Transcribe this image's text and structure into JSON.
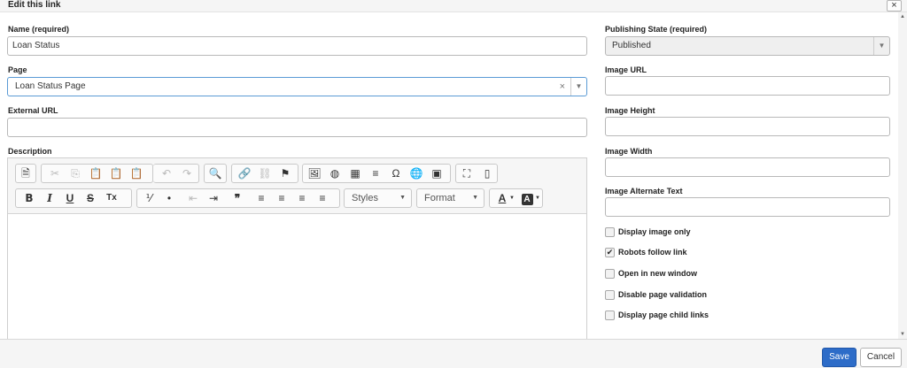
{
  "dialog": {
    "title": "Edit this link",
    "close_icon": "×"
  },
  "left": {
    "name_label": "Name (required)",
    "name_value": "Loan Status",
    "page_label": "Page",
    "page_value": "Loan Status Page",
    "page_clear_icon": "×",
    "page_arrow_icon": "▼",
    "external_url_label": "External URL",
    "external_url_value": "",
    "description_label": "Description"
  },
  "toolbar": {
    "source_icon": "source-icon",
    "icons": {
      "source": "🗎",
      "cut": "✂",
      "copy": "⎘",
      "paste": "📋",
      "paste_text": "📋",
      "paste_word": "📋",
      "undo": "↶",
      "redo": "↷",
      "find": "🔍",
      "link": "🔗",
      "unlink": "⛓",
      "anchor": "⚑",
      "image": "🖼",
      "flash": "◍",
      "table": "▦",
      "hline": "≡",
      "special_char": "Ω",
      "iframe": "🌐",
      "embed": "▣",
      "maximize": "⛶",
      "blocks": "▯",
      "bold": "B",
      "italic": "I",
      "underline": "U",
      "strike": "S",
      "remove_format": "Tx",
      "numbered_list": "⅟",
      "bulleted_list": "•",
      "outdent": "⇤",
      "indent": "⇥",
      "blockquote": "❞",
      "align_left": "≡",
      "align_center": "≡",
      "align_right": "≡",
      "justify": "≡",
      "text_color": "A",
      "bg_color": "A",
      "dropdown": "▼"
    },
    "styles_label": "Styles",
    "format_label": "Format"
  },
  "right": {
    "publishing_label": "Publishing State (required)",
    "publishing_value": "Published",
    "publishing_arrow_icon": "▼",
    "image_url_label": "Image URL",
    "image_height_label": "Image Height",
    "image_width_label": "Image Width",
    "image_alt_label": "Image Alternate Text",
    "checkboxes": [
      {
        "label": "Display image only",
        "checked": ""
      },
      {
        "label": "Robots follow link",
        "checked": "✔"
      },
      {
        "label": "Open in new window",
        "checked": ""
      },
      {
        "label": "Disable page validation",
        "checked": ""
      },
      {
        "label": "Display page child links",
        "checked": ""
      }
    ]
  },
  "scroll": {
    "up_icon": "▲",
    "down_icon": "▼"
  },
  "footer": {
    "save_label": "Save",
    "cancel_label": "Cancel"
  },
  "colors": {
    "save_bg": "#2d6cc8",
    "focus_border": "#5b9bd5"
  }
}
